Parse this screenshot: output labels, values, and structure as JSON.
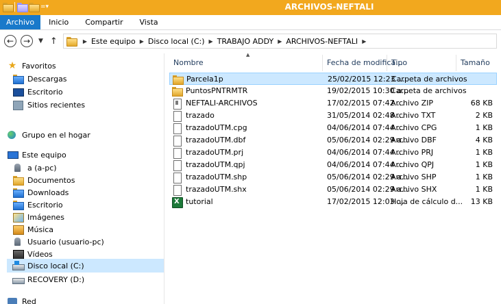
{
  "window": {
    "title": "ARCHIVOS-NEFTALI"
  },
  "ribbon": {
    "tabs": [
      "Archivo",
      "Inicio",
      "Compartir",
      "Vista"
    ]
  },
  "address": {
    "crumbs": [
      "Este equipo",
      "Disco local (C:)",
      "TRABAJO ADDY",
      "ARCHIVOS-NEFTALI"
    ]
  },
  "nav": {
    "favoritos": "Favoritos",
    "descargas": "Descargas",
    "escritorio": "Escritorio",
    "sitios": "Sitios recientes",
    "grupo": "Grupo en el hogar",
    "equipo": "Este equipo",
    "a_pc": "a (a-pc)",
    "documentos": "Documentos",
    "downloads": "Downloads",
    "escritorio2": "Escritorio",
    "imagenes": "Imágenes",
    "musica": "Música",
    "usuario": "Usuario (usuario-pc)",
    "videos": "Vídeos",
    "disco_c": "Disco local (C:)",
    "recovery": "RECOVERY (D:)",
    "red": "Red"
  },
  "columns": {
    "name": "Nombre",
    "date": "Fecha de modifica...",
    "type": "Tipo",
    "size": "Tamaño"
  },
  "files": [
    {
      "name": "Parcela1p",
      "date": "25/02/2015 12:23 ...",
      "type": "Carpeta de archivos",
      "size": "",
      "icon": "folder-icon"
    },
    {
      "name": "PuntosPNTRMTR",
      "date": "19/02/2015 10:30 a...",
      "type": "Carpeta de archivos",
      "size": "",
      "icon": "folder-icon"
    },
    {
      "name": "NEFTALI-ARCHIVOS",
      "date": "17/02/2015 07:42 ...",
      "type": "Archivo ZIP",
      "size": "68 KB",
      "icon": "zip-file-icon"
    },
    {
      "name": "trazado",
      "date": "31/05/2014 02:48 ...",
      "type": "Archivo TXT",
      "size": "2 KB",
      "icon": "document-icon"
    },
    {
      "name": "trazadoUTM.cpg",
      "date": "04/06/2014 07:44 ...",
      "type": "Archivo CPG",
      "size": "1 KB",
      "icon": "document-icon"
    },
    {
      "name": "trazadoUTM.dbf",
      "date": "05/06/2014 02:29 a...",
      "type": "Archivo DBF",
      "size": "4 KB",
      "icon": "document-icon"
    },
    {
      "name": "trazadoUTM.prj",
      "date": "04/06/2014 07:44 ...",
      "type": "Archivo PRJ",
      "size": "1 KB",
      "icon": "document-icon"
    },
    {
      "name": "trazadoUTM.qpj",
      "date": "04/06/2014 07:44 ...",
      "type": "Archivo QPJ",
      "size": "1 KB",
      "icon": "document-icon"
    },
    {
      "name": "trazadoUTM.shp",
      "date": "05/06/2014 02:29 a...",
      "type": "Archivo SHP",
      "size": "1 KB",
      "icon": "document-icon"
    },
    {
      "name": "trazadoUTM.shx",
      "date": "05/06/2014 02:29 a...",
      "type": "Archivo SHX",
      "size": "1 KB",
      "icon": "document-icon"
    },
    {
      "name": "tutorial",
      "date": "17/02/2015 12:03 ...",
      "type": "Hoja de cálculo d...",
      "size": "13 KB",
      "icon": "spreadsheet-icon"
    }
  ],
  "colors": {
    "titlebar": "#f2a81e",
    "file_tab": "#1979ca",
    "selection": "#cce8ff"
  }
}
